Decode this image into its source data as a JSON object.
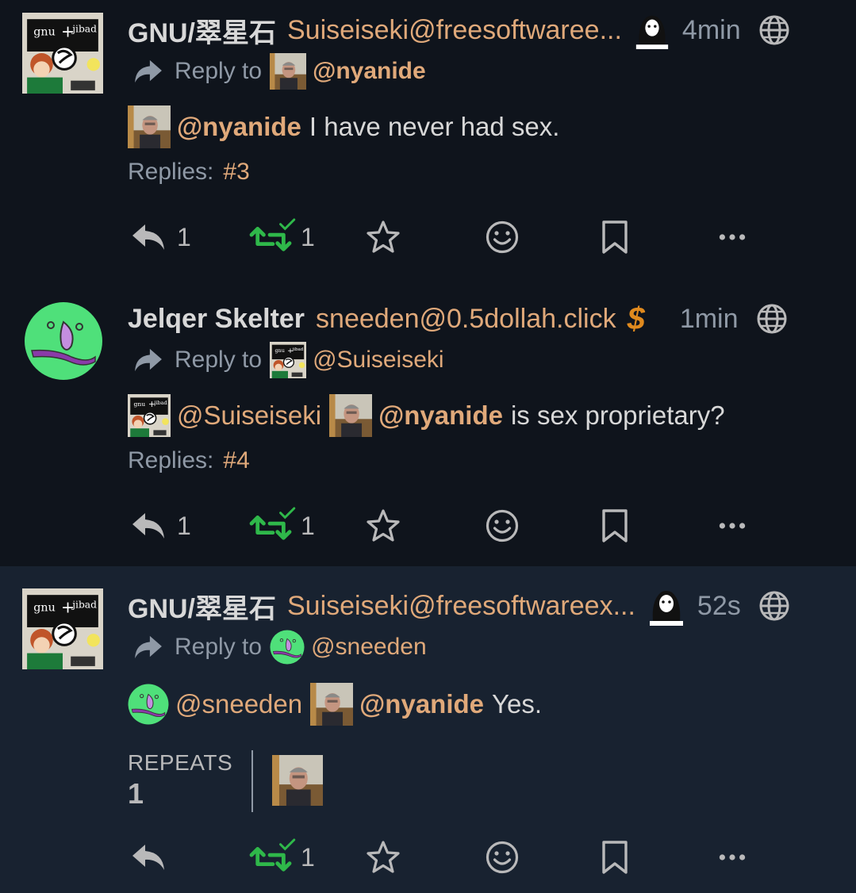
{
  "posts": [
    {
      "name": "GNU/翠星石",
      "acct": "Suiseiseki@freesoftwaree...",
      "time": "4min",
      "reply_label": "Reply to",
      "reply_to": "@nyanide",
      "mentions": [
        "@nyanide"
      ],
      "text": "I have never had sex.",
      "replies_label": "Replies:",
      "replies_num": "#3",
      "reply_count": "1",
      "repeat_count": "1"
    },
    {
      "name": "Jelqer Skelter",
      "acct": "sneeden@0.5dollah.click",
      "badge": "$",
      "time": "1min",
      "reply_label": "Reply to",
      "reply_to": "@Suiseiseki",
      "mentions": [
        "@Suiseiseki",
        "@nyanide"
      ],
      "text": "is sex proprietary?",
      "replies_label": "Replies:",
      "replies_num": "#4",
      "reply_count": "1",
      "repeat_count": "1"
    },
    {
      "name": "GNU/翠星石",
      "acct": "Suiseiseki@freesoftwareex...",
      "time": "52s",
      "reply_label": "Reply to",
      "reply_to": "@sneeden",
      "mentions": [
        "@sneeden",
        "@nyanide"
      ],
      "text": "Yes.",
      "repeats_label": "REPEATS",
      "repeats_num": "1",
      "repeat_count": "1"
    }
  ],
  "colors": {
    "background": "#0f141c",
    "highlight": "#182230",
    "link": "#e0a97a",
    "repeat_green": "#2fb84a"
  },
  "icons": [
    "reply-icon",
    "retweet-icon",
    "star-icon",
    "emoji-icon",
    "bookmark-icon",
    "more-icon",
    "globe-icon",
    "share-arrow-icon"
  ]
}
